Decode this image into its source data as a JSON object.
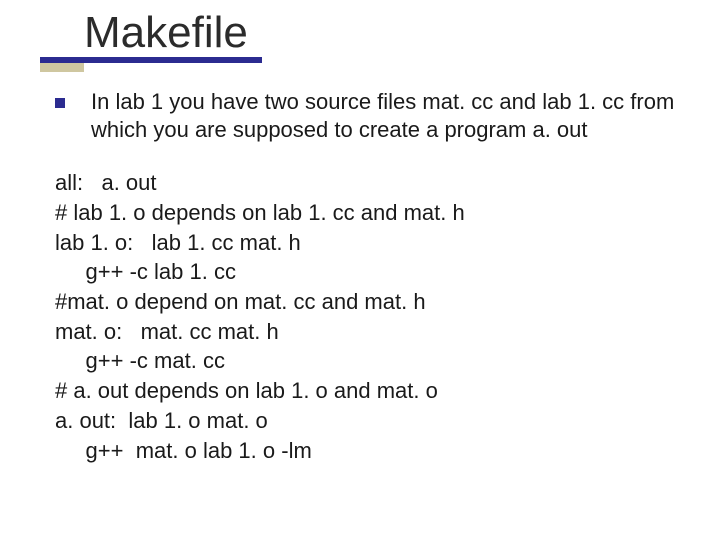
{
  "title": "Makefile",
  "bullet": {
    "text": "In lab 1 you have two source files mat. cc and lab 1. cc from which you are supposed to create a program a. out"
  },
  "code": {
    "lines": [
      "all:   a. out",
      "# lab 1. o depends on lab 1. cc and mat. h",
      "lab 1. o:   lab 1. cc mat. h",
      "     g++ -c lab 1. cc",
      "#mat. o depend on mat. cc and mat. h",
      "mat. o:   mat. cc mat. h",
      "     g++ -c mat. cc",
      "# a. out depends on lab 1. o and mat. o",
      "a. out:  lab 1. o mat. o",
      "     g++  mat. o lab 1. o -lm"
    ]
  }
}
